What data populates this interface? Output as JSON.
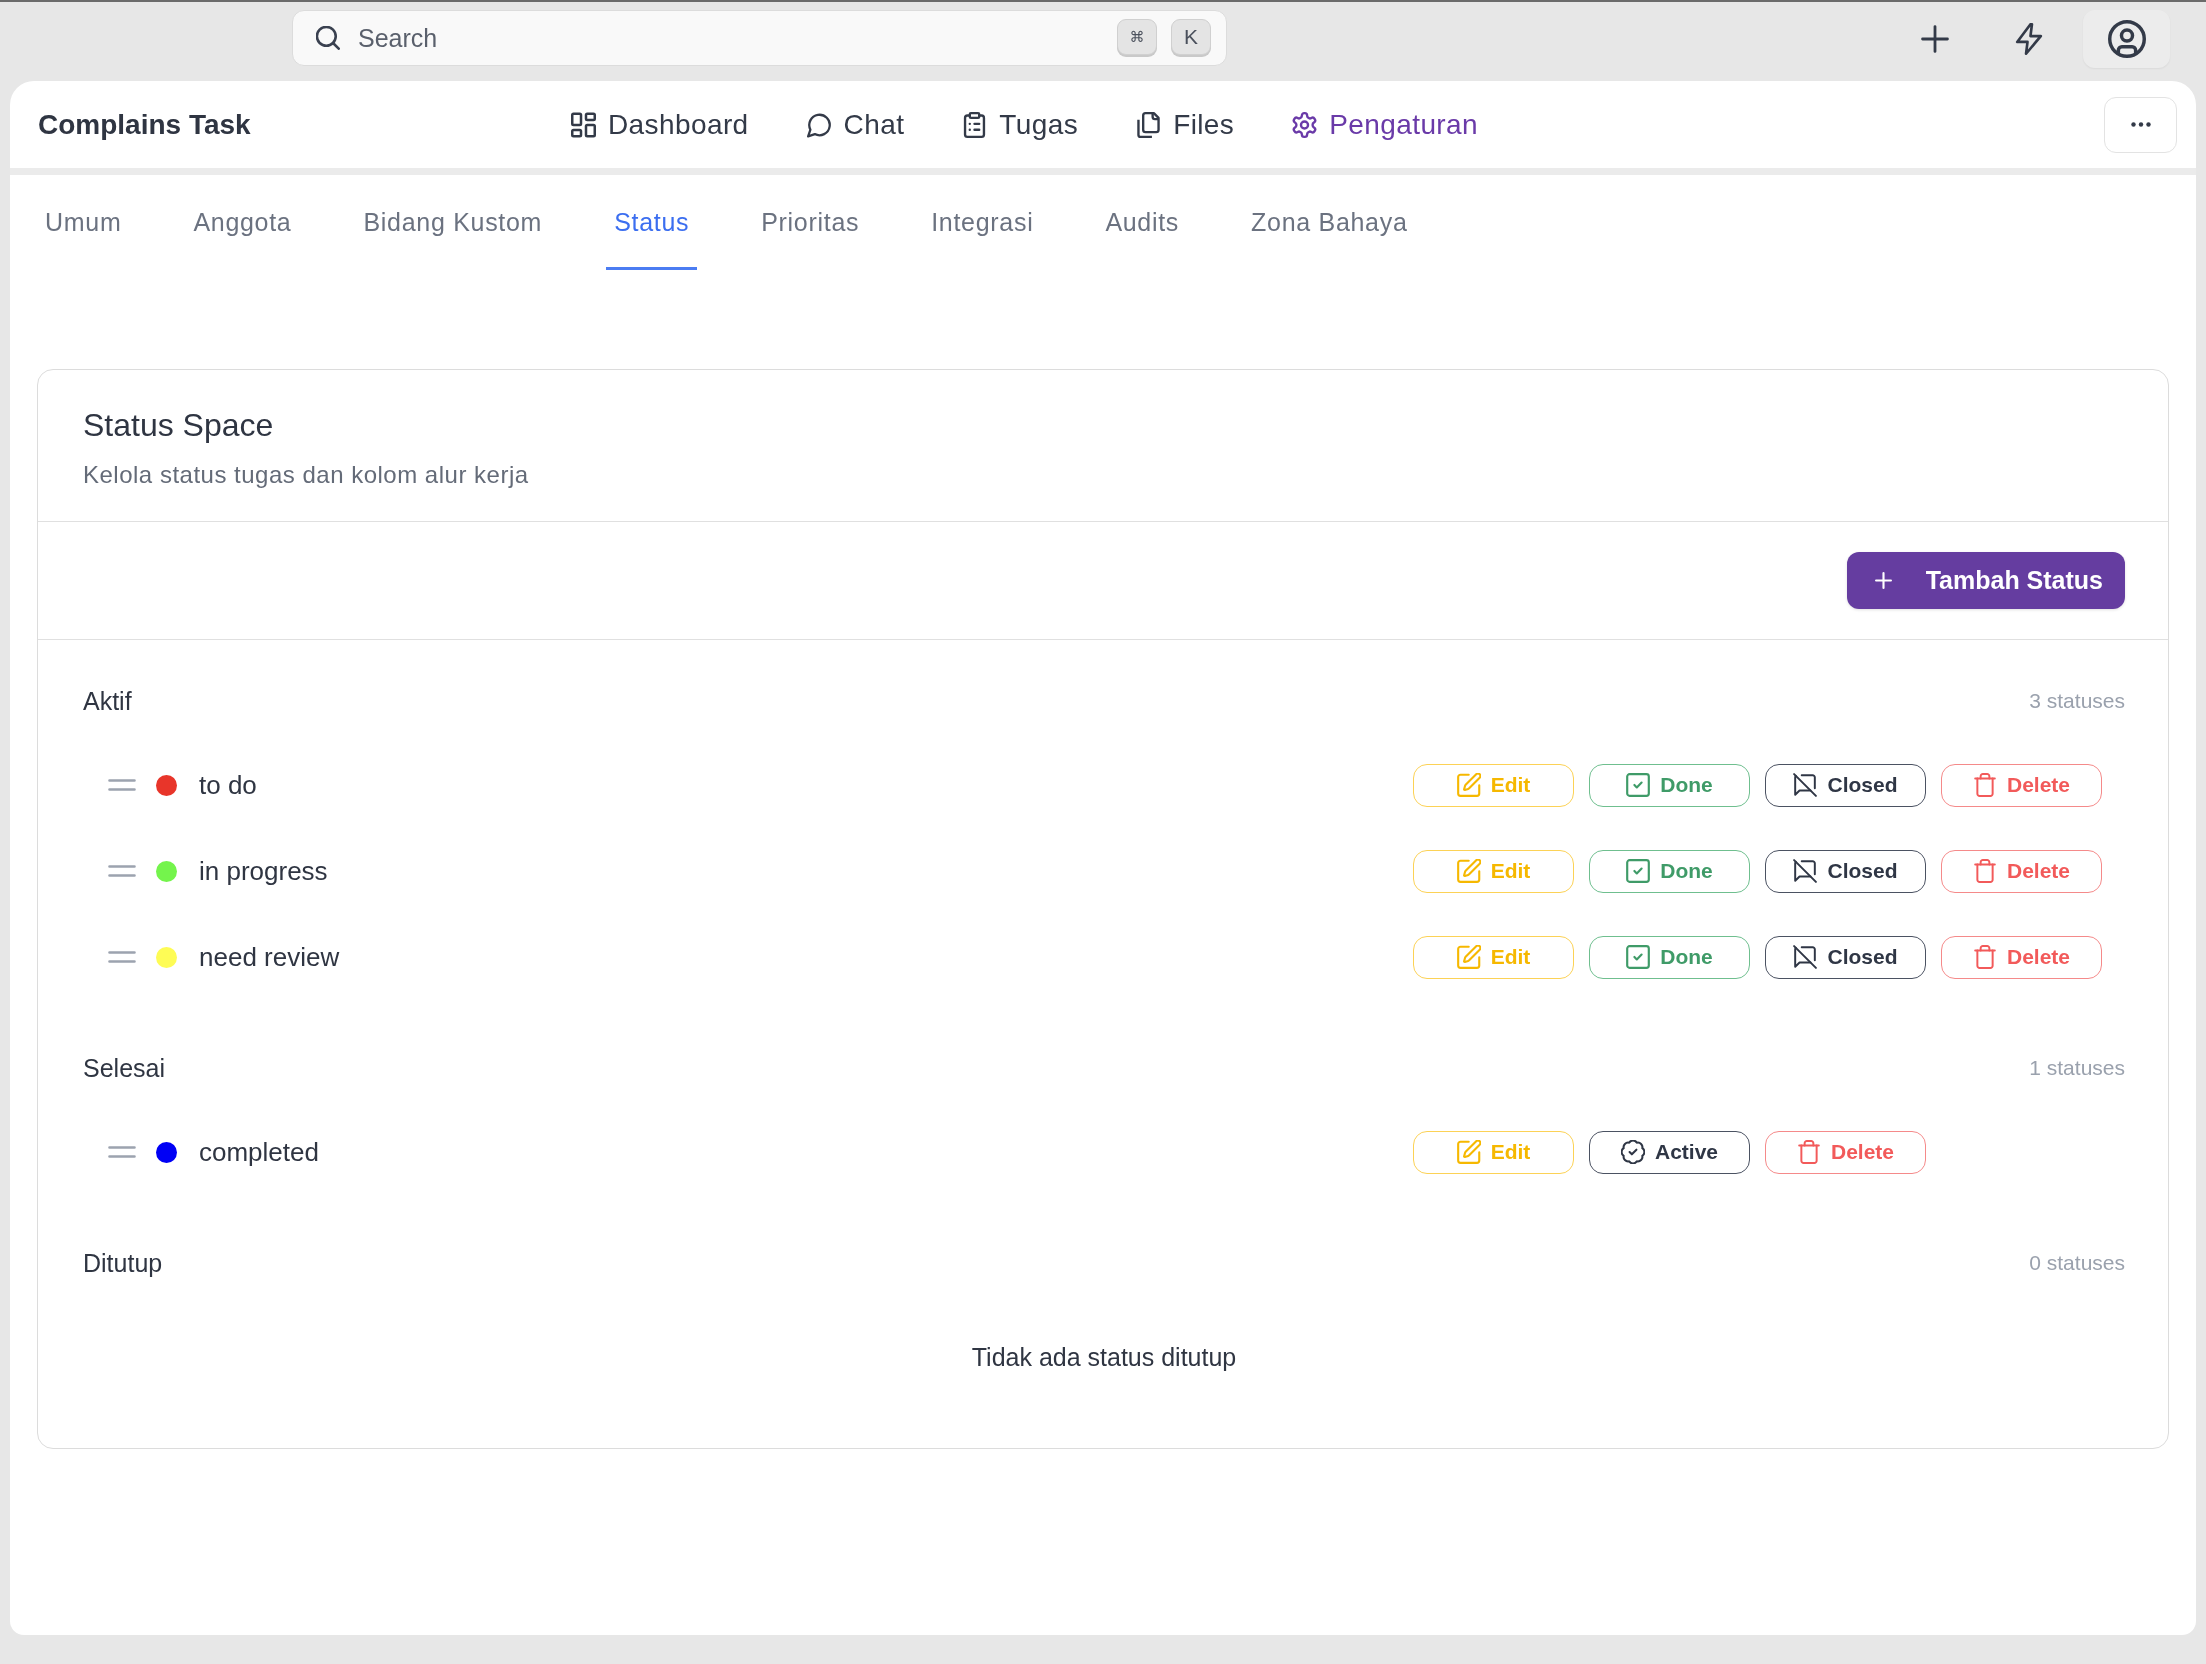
{
  "top_bar": {
    "search": {
      "placeholder": "Search",
      "shortcut_keys": [
        "⌘",
        "K"
      ]
    }
  },
  "header": {
    "title": "Complains Task",
    "nav": [
      {
        "label": "Dashboard",
        "selected": false
      },
      {
        "label": "Chat",
        "selected": false
      },
      {
        "label": "Tugas",
        "selected": false
      },
      {
        "label": "Files",
        "selected": false
      },
      {
        "label": "Pengaturan",
        "selected": true
      }
    ]
  },
  "tabs": [
    {
      "label": "Umum",
      "selected": false
    },
    {
      "label": "Anggota",
      "selected": false
    },
    {
      "label": "Bidang Kustom",
      "selected": false
    },
    {
      "label": "Status",
      "selected": true
    },
    {
      "label": "Prioritas",
      "selected": false
    },
    {
      "label": "Integrasi",
      "selected": false
    },
    {
      "label": "Audits",
      "selected": false
    },
    {
      "label": "Zona Bahaya",
      "selected": false
    }
  ],
  "status_card": {
    "title": "Status Space",
    "subtitle": "Kelola status tugas dan kolom alur kerja",
    "add_button": "Tambah Status",
    "groups": [
      {
        "label": "Aktif",
        "count": "3 statuses",
        "statuses": [
          {
            "name": "to do",
            "color": "#e8352a",
            "actions": [
              {
                "kind": "edit",
                "label": "Edit"
              },
              {
                "kind": "done",
                "label": "Done"
              },
              {
                "kind": "closed",
                "label": "Closed"
              },
              {
                "kind": "delete",
                "label": "Delete"
              }
            ]
          },
          {
            "name": "in progress",
            "color": "#74f44c",
            "actions": [
              {
                "kind": "edit",
                "label": "Edit"
              },
              {
                "kind": "done",
                "label": "Done"
              },
              {
                "kind": "closed",
                "label": "Closed"
              },
              {
                "kind": "delete",
                "label": "Delete"
              }
            ]
          },
          {
            "name": "need review",
            "color": "#fefc55",
            "actions": [
              {
                "kind": "edit",
                "label": "Edit"
              },
              {
                "kind": "done",
                "label": "Done"
              },
              {
                "kind": "closed",
                "label": "Closed"
              },
              {
                "kind": "delete",
                "label": "Delete"
              }
            ]
          }
        ]
      },
      {
        "label": "Selesai",
        "count": "1 statuses",
        "statuses": [
          {
            "name": "completed",
            "color": "#0000f5",
            "actions": [
              {
                "kind": "edit",
                "label": "Edit"
              },
              {
                "kind": "active",
                "label": "Active"
              },
              {
                "kind": "delete",
                "label": "Delete"
              }
            ]
          }
        ]
      },
      {
        "label": "Ditutup",
        "count": "0 statuses",
        "empty_message": "Tidak ada status ditutup"
      }
    ]
  }
}
